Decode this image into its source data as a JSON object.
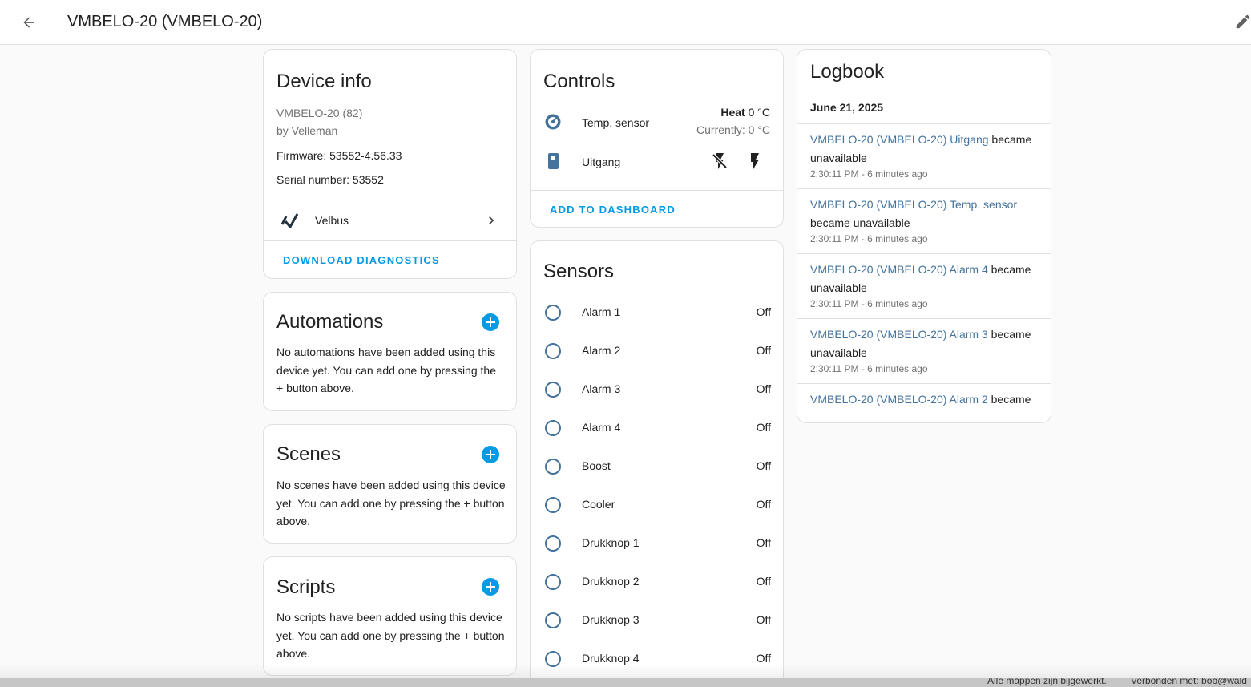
{
  "header": {
    "title": "VMBELO-20 (VMBELO-20)",
    "back_icon": "arrow-left-icon",
    "edit_icon": "pencil-icon"
  },
  "device_info": {
    "title": "Device info",
    "model": "VMBELO-20 (82)",
    "manufacturer": "by Velleman",
    "firmware": "Firmware: 53552-4.56.33",
    "serial": "Serial number: 53552",
    "integration": "Velbus",
    "download_label": "DOWNLOAD DIAGNOSTICS"
  },
  "automations": {
    "title": "Automations",
    "description": "No automations have been added using this device yet. You can add one by pressing the + button above."
  },
  "scenes": {
    "title": "Scenes",
    "description": "No scenes have been added using this device yet. You can add one by pressing the + button above."
  },
  "scripts": {
    "title": "Scripts",
    "description": "No scripts have been added using this device yet. You can add one by pressing the + button above."
  },
  "controls": {
    "title": "Controls",
    "temp_sensor": {
      "name": "Temp. sensor",
      "mode": "Heat",
      "target": "0 °C",
      "current": "Currently: 0 °C"
    },
    "output": {
      "name": "Uitgang"
    },
    "add_to_dashboard": "ADD TO DASHBOARD"
  },
  "sensors": {
    "title": "Sensors",
    "items": [
      {
        "name": "Alarm 1",
        "state": "Off"
      },
      {
        "name": "Alarm 2",
        "state": "Off"
      },
      {
        "name": "Alarm 3",
        "state": "Off"
      },
      {
        "name": "Alarm 4",
        "state": "Off"
      },
      {
        "name": "Boost",
        "state": "Off"
      },
      {
        "name": "Cooler",
        "state": "Off"
      },
      {
        "name": "Drukknop 1",
        "state": "Off"
      },
      {
        "name": "Drukknop 2",
        "state": "Off"
      },
      {
        "name": "Drukknop 3",
        "state": "Off"
      },
      {
        "name": "Drukknop 4",
        "state": "Off"
      }
    ]
  },
  "logbook": {
    "title": "Logbook",
    "date": "June 21, 2025",
    "entries": [
      {
        "entity": "VMBELO-20 (VMBELO-20) Uitgang",
        "message": "became unavailable",
        "time": "2:30:11 PM - 6 minutes ago"
      },
      {
        "entity": "VMBELO-20 (VMBELO-20) Temp. sensor",
        "message": "became unavailable",
        "time": "2:30:11 PM - 6 minutes ago"
      },
      {
        "entity": "VMBELO-20 (VMBELO-20) Alarm 4",
        "message": "became unavailable",
        "time": "2:30:11 PM - 6 minutes ago"
      },
      {
        "entity": "VMBELO-20 (VMBELO-20) Alarm 3",
        "message": "became unavailable",
        "time": "2:30:11 PM - 6 minutes ago"
      },
      {
        "entity": "VMBELO-20 (VMBELO-20) Alarm 2",
        "message": "became",
        "time": ""
      }
    ]
  },
  "status_bar": {
    "left": "Alle mappen zijn bijgewerkt.",
    "right": "Verbonden met: bob@wald"
  },
  "colors": {
    "accent": "#039be5",
    "entity_icon": "#44739e",
    "background": "#fafafa"
  }
}
